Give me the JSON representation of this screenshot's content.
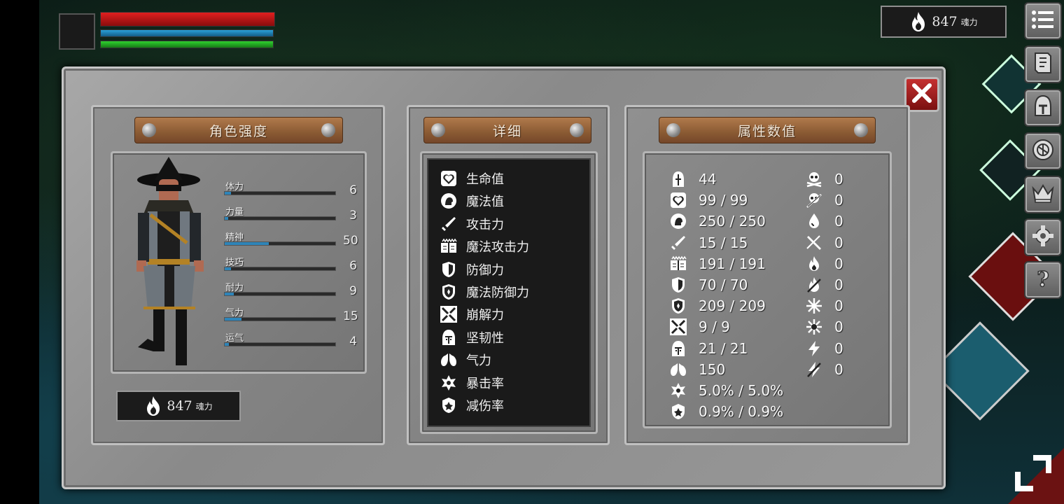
{
  "hud": {
    "health_pct": 100,
    "mana_pct": 100,
    "stamina_pct": 100
  },
  "souls": {
    "amount": "847",
    "unit": "魂力"
  },
  "panels": {
    "character": {
      "title": "角色强度",
      "stats": [
        {
          "label": "体力",
          "value": "6",
          "fill_pct": 6
        },
        {
          "label": "力量",
          "value": "3",
          "fill_pct": 3
        },
        {
          "label": "精神",
          "value": "50",
          "fill_pct": 40
        },
        {
          "label": "技巧",
          "value": "6",
          "fill_pct": 6
        },
        {
          "label": "耐力",
          "value": "9",
          "fill_pct": 8
        },
        {
          "label": "气力",
          "value": "15",
          "fill_pct": 15
        },
        {
          "label": "运气",
          "value": "4",
          "fill_pct": 4
        }
      ]
    },
    "details": {
      "title": "详细",
      "items": [
        {
          "icon": "heart-icon",
          "label": "生命值"
        },
        {
          "icon": "head-icon",
          "label": "魔法值"
        },
        {
          "icon": "sword-icon",
          "label": "攻击力"
        },
        {
          "icon": "spellbook-icon",
          "label": "魔法攻击力"
        },
        {
          "icon": "shield-icon",
          "label": "防御力"
        },
        {
          "icon": "magic-shield-icon",
          "label": "魔法防御力"
        },
        {
          "icon": "broken-sword-icon",
          "label": "崩解力"
        },
        {
          "icon": "helmet-icon",
          "label": "坚韧性"
        },
        {
          "icon": "lungs-icon",
          "label": "气力"
        },
        {
          "icon": "critical-star-icon",
          "label": "暴击率"
        },
        {
          "icon": "damage-reduction-icon",
          "label": "减伤率"
        }
      ]
    },
    "attributes": {
      "title": "属性数值",
      "left_column": [
        {
          "icon": "level-helmet-icon",
          "value": "44"
        },
        {
          "icon": "heart-icon",
          "value": "99 / 99"
        },
        {
          "icon": "head-icon",
          "value": "250 / 250"
        },
        {
          "icon": "sword-icon",
          "value": "15 / 15"
        },
        {
          "icon": "spellbook-icon",
          "value": "191 / 191"
        },
        {
          "icon": "shield-icon",
          "value": "70 / 70"
        },
        {
          "icon": "magic-shield-icon",
          "value": "209 / 209"
        },
        {
          "icon": "broken-sword-icon",
          "value": "9 / 9"
        },
        {
          "icon": "helmet-icon",
          "value": "21 / 21"
        },
        {
          "icon": "lungs-icon",
          "value": "150"
        },
        {
          "icon": "critical-star-icon",
          "value": "5.0% / 5.0%"
        },
        {
          "icon": "damage-reduction-icon",
          "value": "0.9% / 0.9%"
        }
      ],
      "right_column": [
        {
          "icon": "poison-skull-icon",
          "value": "0"
        },
        {
          "icon": "bleed-skull-icon",
          "value": "0"
        },
        {
          "icon": "water-drop-icon",
          "value": "0"
        },
        {
          "icon": "slash-resist-icon",
          "value": "0"
        },
        {
          "icon": "fire-icon",
          "value": "0"
        },
        {
          "icon": "fire-resist-icon",
          "value": "0"
        },
        {
          "icon": "frost-icon",
          "value": "0"
        },
        {
          "icon": "frost-resist-icon",
          "value": "0"
        },
        {
          "icon": "lightning-icon",
          "value": "0"
        },
        {
          "icon": "lightning-resist-icon",
          "value": "0"
        }
      ]
    }
  },
  "sidebar": {
    "buttons": [
      "menu-icon",
      "map-scroll-icon",
      "helmet-icon",
      "rune-emblem-icon",
      "crown-icon",
      "gear-icon",
      "help-icon"
    ]
  },
  "colors": {
    "health": "#d41c1c",
    "mana": "#1f86bf",
    "stamina": "#22b422",
    "stat_fill": "#2e84b8",
    "close": "#a82020"
  }
}
